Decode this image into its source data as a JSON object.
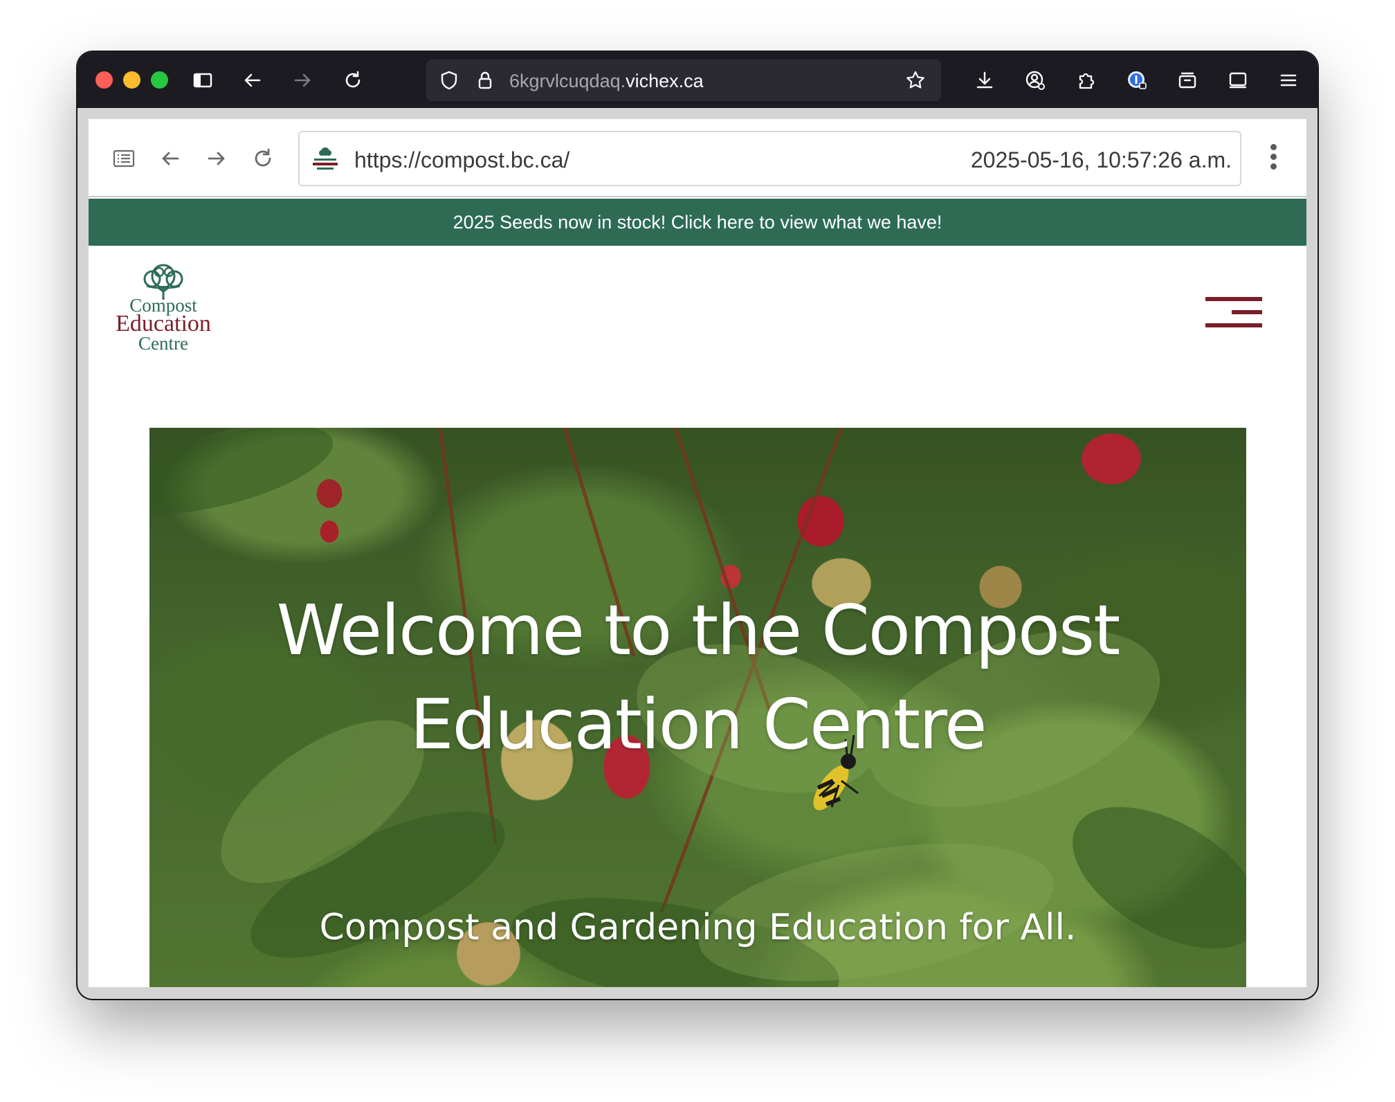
{
  "browser": {
    "address_host_dim": "6kgrvlcuqdaq.",
    "address_host_main": "vichex.ca",
    "icons": {
      "sidebar": "sidebar-icon",
      "back": "back-arrow-icon",
      "forward": "forward-arrow-icon",
      "reload": "reload-icon",
      "shield": "shield-icon",
      "lock": "lock-icon",
      "bookmark": "star-icon",
      "downloads": "download-icon",
      "account": "account-icon",
      "extensions": "extensions-icon",
      "password_manager": "password-manager-icon",
      "container": "container-icon",
      "tabs": "tab-overview-icon",
      "menu": "menu-icon"
    },
    "traffic_colors": [
      "#ff5f57",
      "#febc2e",
      "#28c840"
    ]
  },
  "archive": {
    "url": "https://compost.bc.ca/",
    "timestamp": "2025-05-16, 10:57:26 a.m."
  },
  "site": {
    "promo_text": "2025 Seeds now in stock! Click here to view what we have!",
    "logo": {
      "line1": "Compost",
      "line2": "Education",
      "line3": "Centre"
    },
    "hero": {
      "title": "Welcome to the Compost Education Centre",
      "subtitle": "Compost and Gardening Education for All."
    },
    "colors": {
      "promo_bg": "#2e6b55",
      "brand_red": "#7a1e2a",
      "brand_green": "#2e6b55"
    }
  }
}
